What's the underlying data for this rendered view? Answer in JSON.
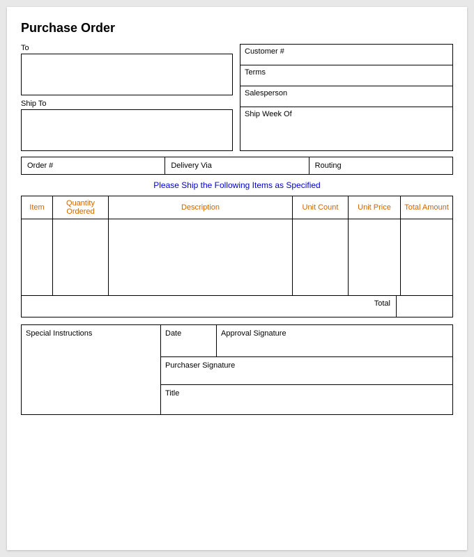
{
  "title": "Purchase Order",
  "labels": {
    "to": "To",
    "ship_to": "Ship To",
    "customer_num": "Customer #",
    "terms": "Terms",
    "salesperson": "Salesperson",
    "ship_week_of": "Ship Week Of",
    "order_num": "Order #",
    "delivery_via": "Delivery Via",
    "routing": "Routing",
    "notice": "Please Ship the Following Items as Specified",
    "total": "Total",
    "special_instructions": "Special Instructions",
    "date": "Date",
    "approval_signature": "Approval Signature",
    "purchaser_signature": "Purchaser Signature",
    "title": "Title"
  },
  "table": {
    "headers": [
      "Item",
      "Quantity Ordered",
      "Description",
      "Unit Count",
      "Unit Price",
      "Total Amount"
    ]
  }
}
